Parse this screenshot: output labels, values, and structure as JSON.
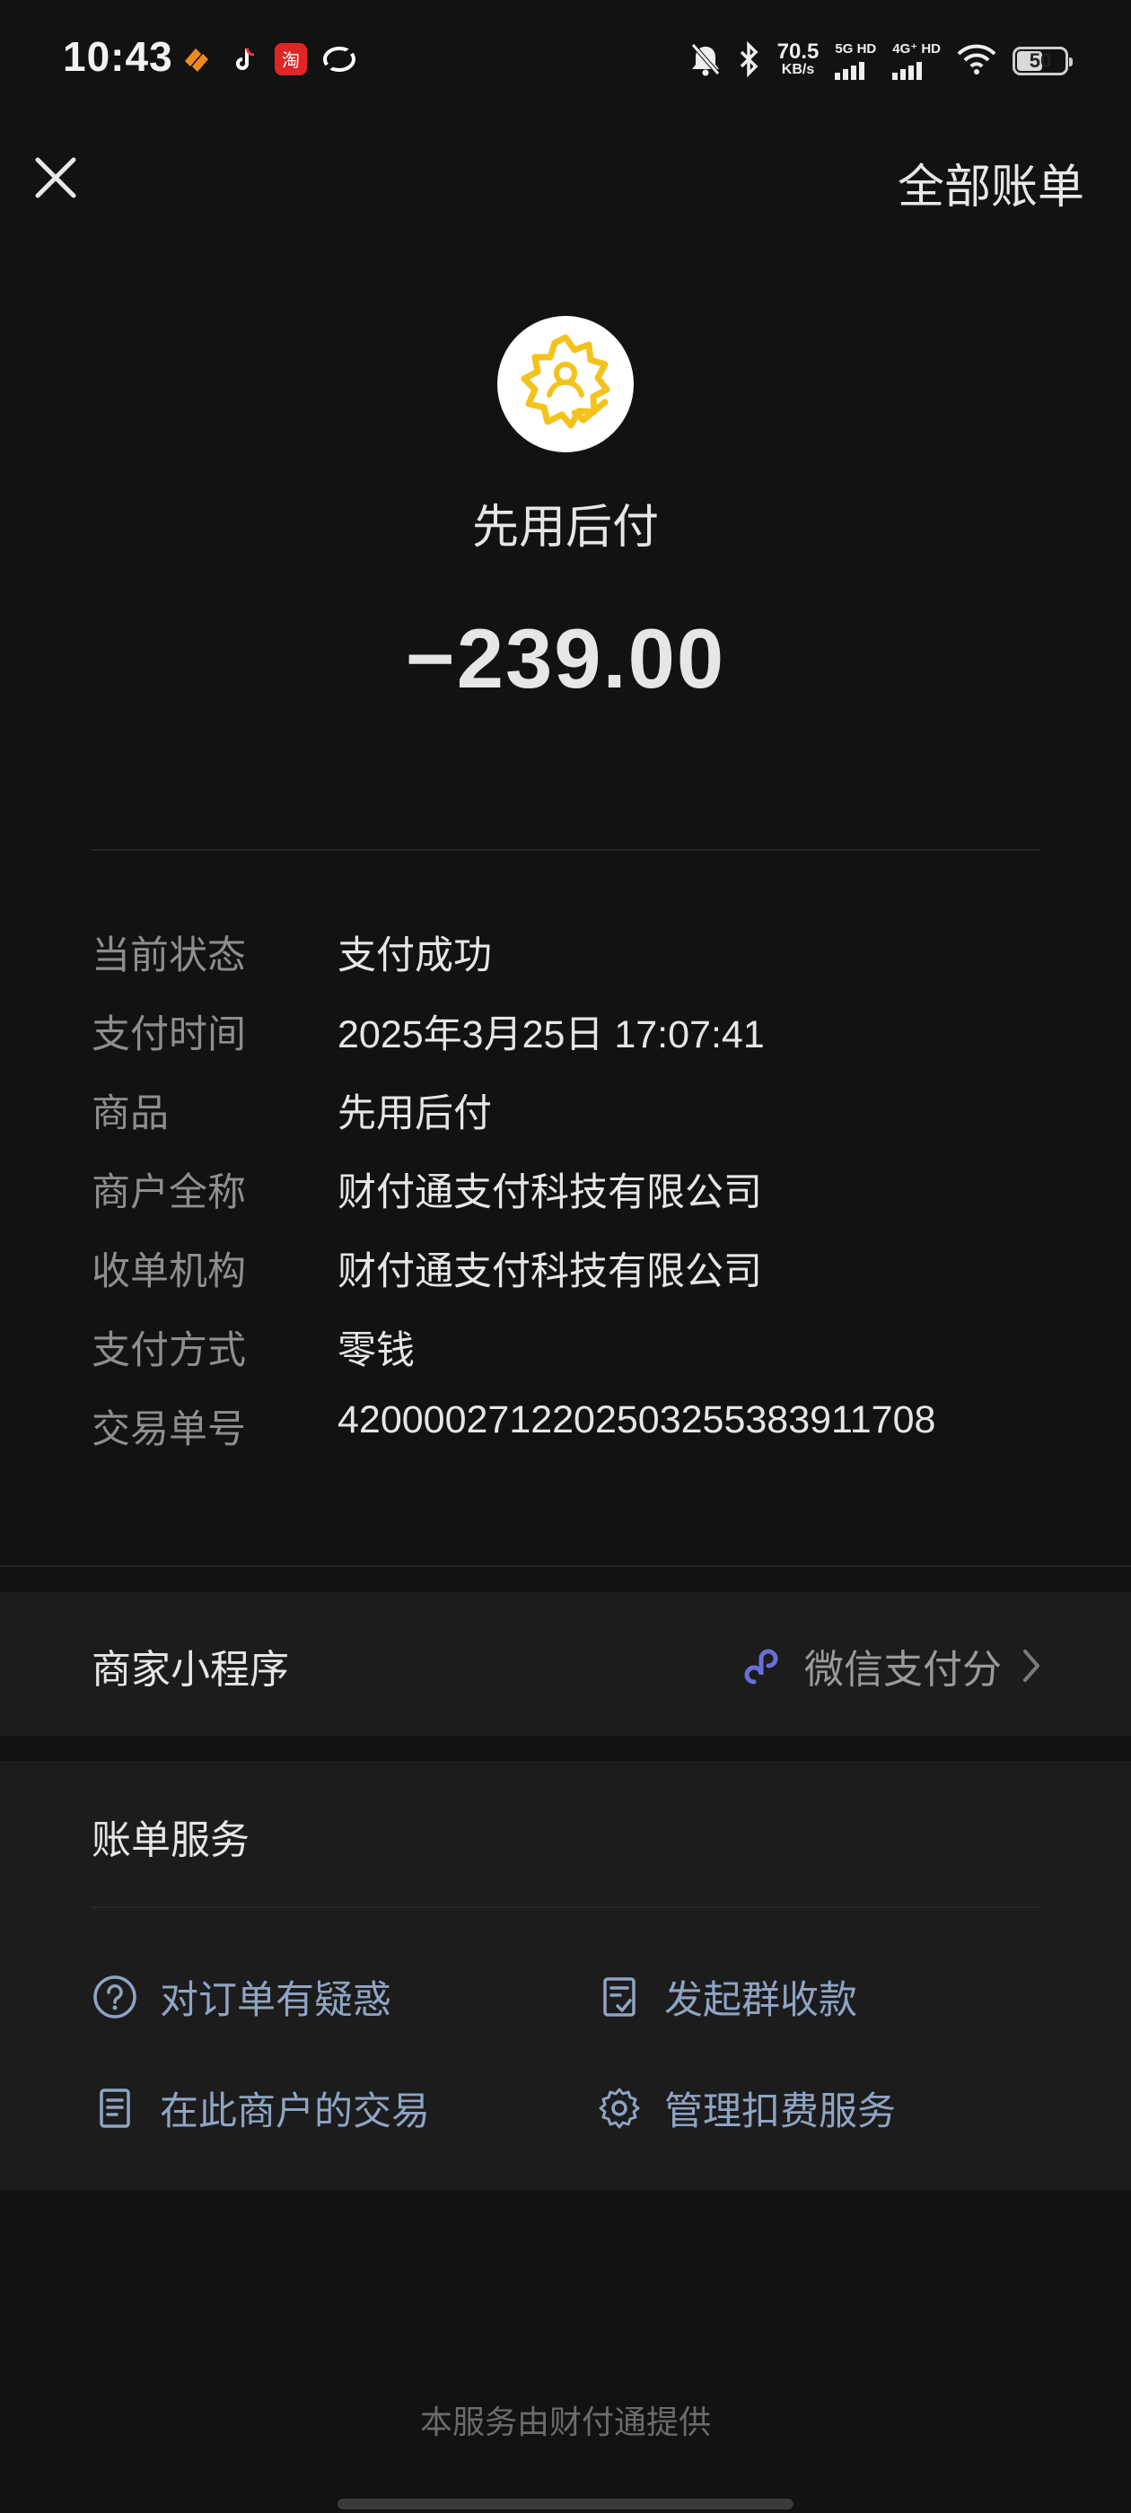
{
  "status_bar": {
    "time": "10:43",
    "net_speed_value": "70.5",
    "net_speed_unit": "KB/s",
    "sim1_label": "5G HD",
    "sim2_label": "4G⁺ HD",
    "battery": "50",
    "app_icons": [
      "notification-app-orange-icon",
      "tiktok-icon",
      "taobao-icon",
      "app-ring-icon"
    ]
  },
  "topbar": {
    "all_bills": "全部账单"
  },
  "header": {
    "merchant": "先用后付",
    "amount": "−239.00",
    "logo_color": "#f4c21c"
  },
  "details": [
    {
      "key": "当前状态",
      "value": "支付成功"
    },
    {
      "key": "支付时间",
      "value": "2025年3月25日 17:07:41"
    },
    {
      "key": "商品",
      "value": "先用后付"
    },
    {
      "key": "商户全称",
      "value": "财付通支付科技有限公司"
    },
    {
      "key": "收单机构",
      "value": "财付通支付科技有限公司"
    },
    {
      "key": "支付方式",
      "value": "零钱"
    },
    {
      "key": "交易单号",
      "value": "4200002712202503255383911708"
    }
  ],
  "mini_program": {
    "label": "商家小程序",
    "name": "微信支付分",
    "icon_color": "#6a6fd8"
  },
  "services": {
    "title": "账单服务",
    "items": [
      {
        "label": "对订单有疑惑",
        "icon": "question-icon"
      },
      {
        "label": "发起群收款",
        "icon": "checklist-icon"
      },
      {
        "label": "在此商户的交易",
        "icon": "document-icon"
      },
      {
        "label": "管理扣费服务",
        "icon": "gear-icon"
      }
    ],
    "accent": "#8fa4c4"
  },
  "footer": "本服务由财付通提供"
}
